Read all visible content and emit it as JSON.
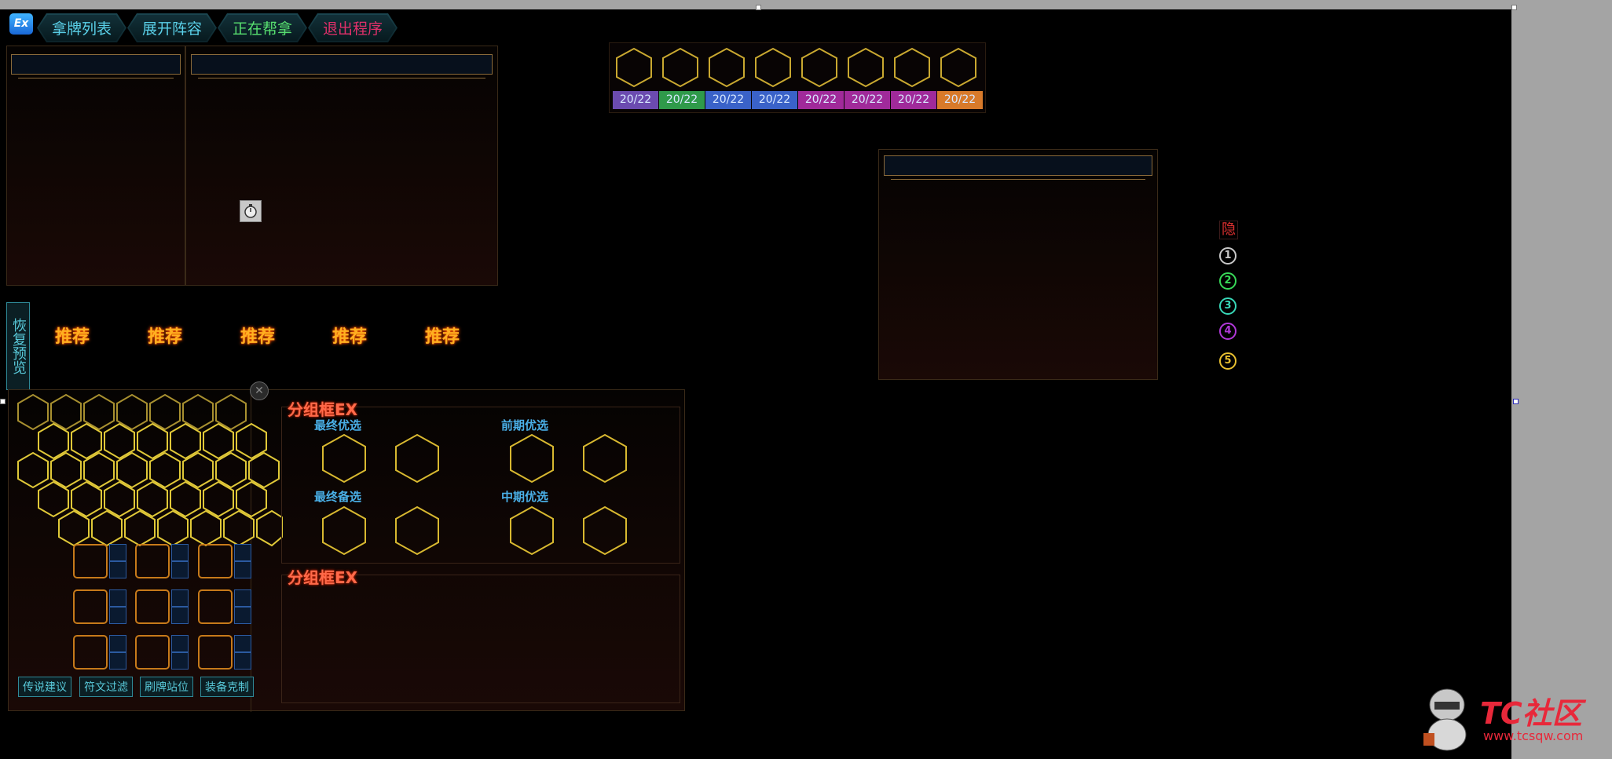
{
  "app": {
    "logo_text": "Ex"
  },
  "tabs": [
    {
      "label": "拿牌列表",
      "color": "#5ad0e8"
    },
    {
      "label": "展开阵容",
      "color": "#5ad0e8"
    },
    {
      "label": "正在帮拿",
      "color": "#58e070"
    },
    {
      "label": "退出程序",
      "color": "#e0306a"
    }
  ],
  "counters": [
    {
      "value": "20/22",
      "color": "#6b4bb0"
    },
    {
      "value": "20/22",
      "color": "#2f9a4a"
    },
    {
      "value": "20/22",
      "color": "#3a62c8"
    },
    {
      "value": "20/22",
      "color": "#3a62c8"
    },
    {
      "value": "20/22",
      "color": "#a02a9a"
    },
    {
      "value": "20/22",
      "color": "#a02a9a"
    },
    {
      "value": "20/22",
      "color": "#a02a9a"
    },
    {
      "value": "20/22",
      "color": "#d87a2a"
    }
  ],
  "side_menu": {
    "hide_label": "隐",
    "numbers": [
      {
        "label": "1",
        "color": "#c8c8c8"
      },
      {
        "label": "2",
        "color": "#38d858"
      },
      {
        "label": "3",
        "color": "#38d8b8"
      },
      {
        "label": "4",
        "color": "#b038d8"
      },
      {
        "label": "5",
        "color": "#e8c030"
      }
    ]
  },
  "restore_preview": "恢复预览",
  "recommend_labels": [
    "推荐",
    "推荐",
    "推荐",
    "推荐",
    "推荐"
  ],
  "group_boxes": [
    {
      "title": "分组框EX"
    },
    {
      "title": "分组框EX"
    }
  ],
  "slots": {
    "final_priority": "最终优选",
    "early_priority": "前期优选",
    "final_backup": "最终备选",
    "mid_priority": "中期优选"
  },
  "bottom_buttons": [
    "传说建议",
    "符文过滤",
    "刷牌站位",
    "装备克制"
  ],
  "watermark": {
    "text": "TC社区",
    "url": "www.tcsqw.com"
  },
  "colors": {
    "hex_stroke": "#d8b830",
    "hex_stroke_dim": "#c9a830",
    "panel_border": "#3a2a18"
  }
}
